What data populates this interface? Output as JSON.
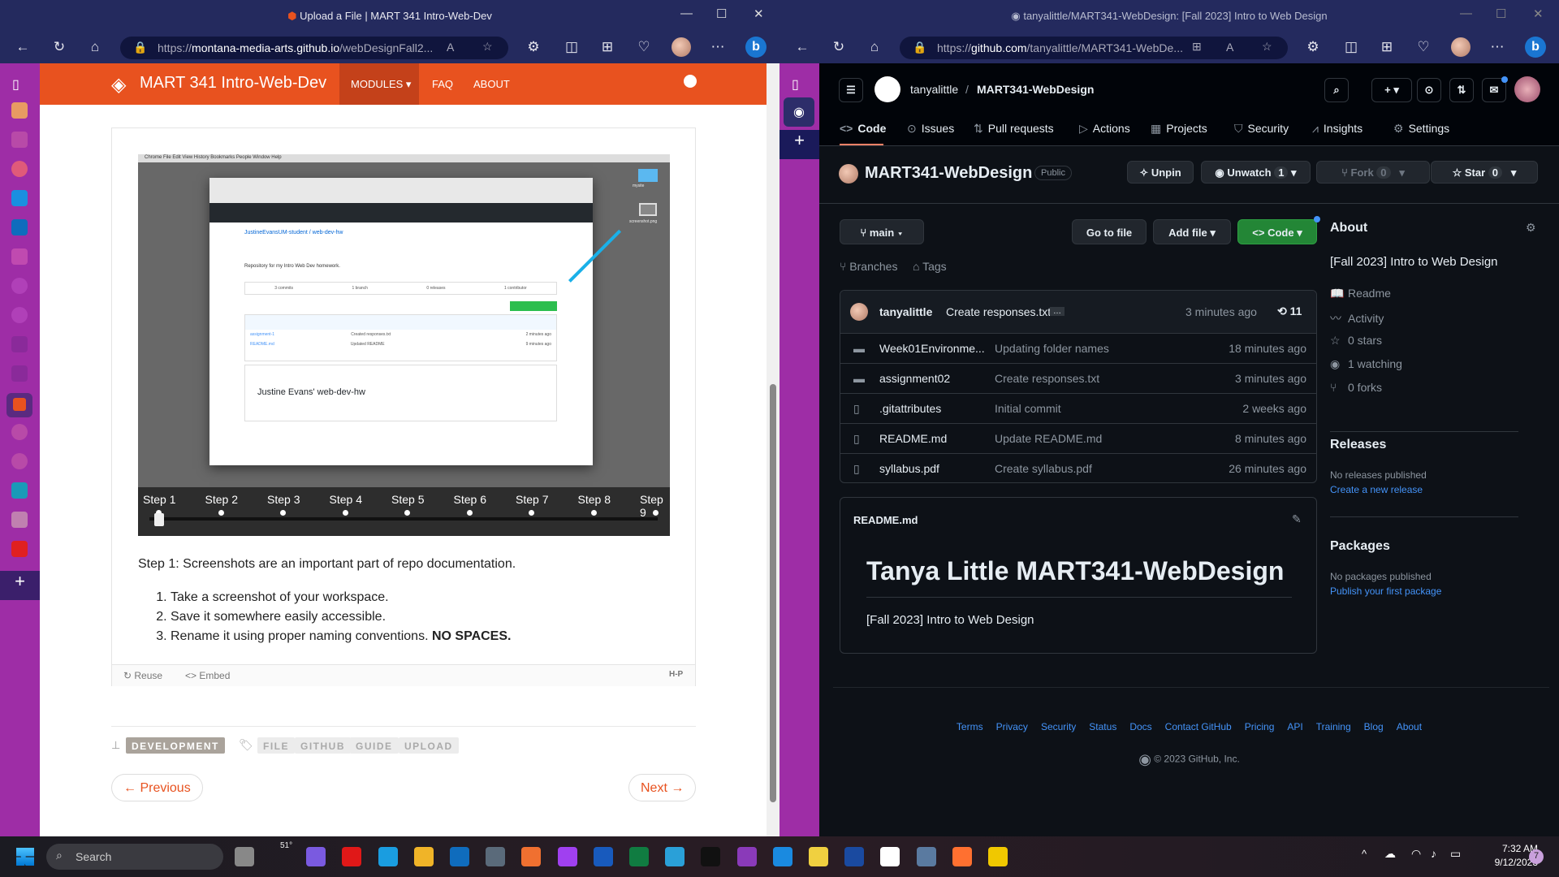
{
  "left_window": {
    "title": "Upload a File | MART 341 Intro-Web-Dev",
    "url_prefix": "https://",
    "url_host": "montana-media-arts.github.io",
    "url_path": "/webDesignFall2...",
    "site": {
      "title": "MART 341 Intro-Web-Dev",
      "nav": [
        "MODULES",
        "FAQ",
        "ABOUT"
      ]
    },
    "embedded_screenshot": {
      "menubar": "Chrome  File  Edit  View  History  Bookmarks  People  Window  Help",
      "repo": "JustineEvansUM-student / web-dev-hw",
      "description": "Repository for my Intro Web Dev homework.",
      "stats": [
        "3 commits",
        "1 branch",
        "0 releases",
        "1 contributor"
      ],
      "files": [
        [
          "assignment-1",
          "Created responses.txt",
          "2 minutes ago"
        ],
        [
          "README.md",
          "Updated README",
          "9 minutes ago"
        ]
      ],
      "readme_title": "Justine Evans' web-dev-hw",
      "desktop_files": [
        "mysite",
        "screenshot.png"
      ]
    },
    "steps": [
      "Step 1",
      "Step 2",
      "Step 3",
      "Step 4",
      "Step 5",
      "Step 6",
      "Step 7",
      "Step 8",
      "Step 9"
    ],
    "current_step": 1,
    "step_text": "Step 1: Screenshots are an important part of repo documentation.",
    "list": [
      "Take a screenshot of your workspace.",
      "Save it somewhere easily accessible.",
      "Rename it using proper naming conventions. "
    ],
    "list_bold": "NO SPACES.",
    "h5p": {
      "reuse": "Reuse",
      "embed": "Embed",
      "logo": "H-P"
    },
    "category": "DEVELOPMENT",
    "tags": [
      "FILE",
      "GITHUB",
      "GUIDE",
      "UPLOAD"
    ],
    "prev": "← Previous",
    "next": "Next →"
  },
  "right_window": {
    "title": "tanyalittle/MART341-WebDesign: [Fall 2023] Intro to Web Design",
    "url_prefix": "https://",
    "url_host": "github.com",
    "url_path": "/tanyalittle/MART341-WebDe...",
    "owner": "tanyalittle",
    "repo": "MART341-WebDesign",
    "tabs": [
      "Code",
      "Issues",
      "Pull requests",
      "Actions",
      "Projects",
      "Security",
      "Insights",
      "Settings"
    ],
    "visibility": "Public",
    "buttons": {
      "unpin": "Unpin",
      "unwatch": "Unwatch",
      "watch_count": "1",
      "fork": "Fork",
      "fork_count": "0",
      "star": "Star",
      "star_count": "0"
    },
    "branch": "main",
    "go_to_file": "Go to file",
    "add_file": "Add file",
    "code": "Code",
    "branches": "Branches",
    "tags": "Tags",
    "commit": {
      "author": "tanyalittle",
      "message": "Create responses.txt",
      "time": "3 minutes ago",
      "count": "11"
    },
    "files": [
      {
        "type": "folder",
        "name": "Week01Environme...",
        "msg": "Updating folder names",
        "time": "18 minutes ago"
      },
      {
        "type": "folder",
        "name": "assignment02",
        "msg": "Create responses.txt",
        "time": "3 minutes ago"
      },
      {
        "type": "file",
        "name": ".gitattributes",
        "msg": "Initial commit",
        "time": "2 weeks ago"
      },
      {
        "type": "file",
        "name": "README.md",
        "msg": "Update README.md",
        "time": "8 minutes ago"
      },
      {
        "type": "file",
        "name": "syllabus.pdf",
        "msg": "Create syllabus.pdf",
        "time": "26 minutes ago"
      }
    ],
    "readme": {
      "label": "README.md",
      "title": "Tanya Little MART341-WebDesign",
      "body": "[Fall 2023] Intro to Web Design"
    },
    "about": {
      "heading": "About",
      "desc": "[Fall 2023] Intro to Web Design",
      "items": [
        "Readme",
        "Activity",
        "0 stars",
        "1 watching",
        "0 forks"
      ]
    },
    "releases": {
      "heading": "Releases",
      "none": "No releases published",
      "link": "Create a new release"
    },
    "packages": {
      "heading": "Packages",
      "none": "No packages published",
      "link": "Publish your first package"
    },
    "footer": [
      "Terms",
      "Privacy",
      "Security",
      "Status",
      "Docs",
      "Contact GitHub",
      "Pricing",
      "API",
      "Training",
      "Blog",
      "About"
    ],
    "copyright": "© 2023 GitHub, Inc."
  },
  "taskbar": {
    "search": "Search",
    "weather": "51°",
    "time": "7:32 AM",
    "date": "9/12/2023",
    "notifications": "7",
    "apps": [
      "task-view",
      "teams",
      "opera",
      "edge",
      "file-explorer",
      "outlook",
      "calculator",
      "chrome-canary",
      "messenger",
      "word",
      "excel",
      "notepad",
      "inkscape",
      "github-desktop",
      "vscode",
      "python",
      "powershell",
      "amazon",
      "settings",
      "firefox",
      "sticky-notes"
    ]
  },
  "colors": {
    "orange": "#e8521f",
    "github_bg": "#0d1117",
    "edge_bar": "#9e2da6",
    "green": "#238636"
  }
}
